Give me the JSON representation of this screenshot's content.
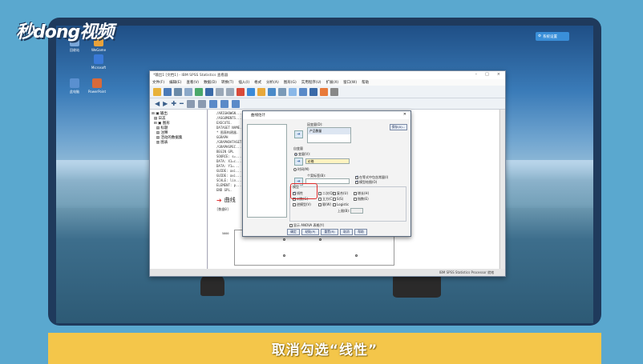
{
  "brand": {
    "logo": "秒dong视频"
  },
  "caption": "取消勾选“线性”",
  "desktop": {
    "icons": [
      {
        "label": "回收站",
        "color": "#7aa6d8"
      },
      {
        "label": "WeGame",
        "color": "#e8a23a"
      },
      {
        "label": "Microsoft",
        "color": "#3a7ad8"
      },
      {
        "label": "此电脑",
        "color": "#5a90d0"
      },
      {
        "label": "PowerPoint",
        "color": "#d86a3a"
      }
    ],
    "taskbar_button": "系统设置"
  },
  "spss": {
    "title": "*输出1 [文档1] - IBM SPSS Statistics 查看器",
    "window_controls": [
      "–",
      "□",
      "×"
    ],
    "menu": [
      "文件(F)",
      "编辑(E)",
      "查看(V)",
      "数据(D)",
      "转换(T)",
      "插入(I)",
      "格式",
      "分析(A)",
      "图形(G)",
      "实用程序(U)",
      "扩展(X)",
      "窗口(W)",
      "帮助"
    ],
    "tree": [
      "输出",
      "日志",
      "图形",
      "标题",
      "注释",
      "活动的数据集",
      "图表"
    ],
    "output_lines": [
      "/ARIGHOWGN...",
      "/ASGUMENTS...",
      "EXECUTE.",
      "DATASET NAME...",
      "* 图表构建器.",
      "GGRAPH",
      "  /GRAPHDATASET...",
      "  /GRAPHSPEC...",
      "BEGIN GPL",
      "  SOURCE: s=...",
      "  DATA: X1=c...",
      "  DATA: Y1=...",
      "  GUIDE: axi...",
      "  GUIDE: axi...",
      "  SCALE: lin...",
      "  ELEMENT: p...",
      "END GPL."
    ],
    "section_heading": "曲线",
    "bracket_label": "[数据0]",
    "axis_value": "5000",
    "status": "IBM SPSS Statistics Processor 就绪"
  },
  "dialog": {
    "title": "曲线估计",
    "dependent_label": "因变量(D):",
    "dependent_value": "产品数量",
    "statistics_button": "保存(A)...",
    "independent_label": "自变量",
    "variable_option": "变量(V):",
    "variable_value": "价格",
    "time_option": "时间(M)",
    "case_label_label": "个案标签(B):",
    "include_constant": "在等式中包含常量(I)",
    "plot_models": "模型绘图(O)",
    "models_label": "模型",
    "models": [
      {
        "label": "线性",
        "checked": true
      },
      {
        "label": "二次(Q)",
        "checked": false
      },
      {
        "label": "复合(U)",
        "checked": false
      },
      {
        "label": "增长(H)",
        "checked": false
      },
      {
        "label": "对数(G)",
        "checked": false
      },
      {
        "label": "立方(C)",
        "checked": false
      },
      {
        "label": "S(S)",
        "checked": false
      },
      {
        "label": "指数(E)",
        "checked": false
      },
      {
        "label": "逆模型(V)",
        "checked": false
      },
      {
        "label": "幂(W)",
        "checked": false
      },
      {
        "label": "Logistic",
        "checked": false
      }
    ],
    "upper_bound_label": "上限(B):",
    "anova_label": "显示 ANOVA 表格(Y)",
    "buttons": [
      "确定",
      "粘贴(P)",
      "重置(R)",
      "取消",
      "帮助"
    ]
  }
}
